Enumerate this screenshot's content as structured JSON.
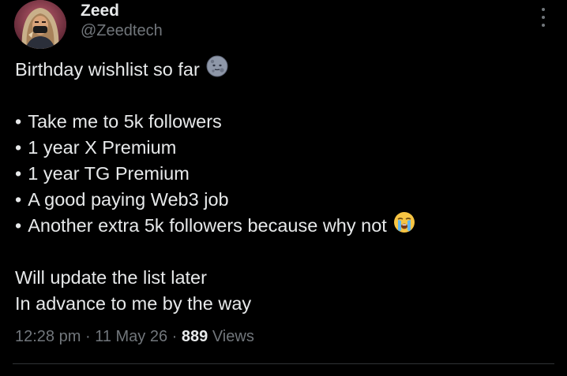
{
  "author": {
    "display_name": "Zeed",
    "handle": "@Zeedtech",
    "avatar_icon": "avatar-hijab-woman-icon"
  },
  "more_icon": "more-vertical-icon",
  "post": {
    "intro": "Birthday wishlist so far",
    "intro_emoji": "new-moon-face-emoji",
    "bullet_char": "•",
    "items": [
      "Take me to 5k followers",
      "1 year X Premium",
      "1 year TG Premium",
      "A good paying Web3 job",
      "Another extra 5k followers because why not"
    ],
    "last_item_emoji": "loudly-crying-face-emoji",
    "outro": [
      "Will update the list later",
      "In advance to me by the way"
    ]
  },
  "meta": {
    "time": "12:28 pm",
    "separator": "·",
    "date": "11 May 26",
    "views_count": "889",
    "views_label": "Views"
  },
  "colors": {
    "background": "#000000",
    "primary_text": "#e7e9ea",
    "secondary_text": "#71767b",
    "divider": "#2f3336"
  }
}
